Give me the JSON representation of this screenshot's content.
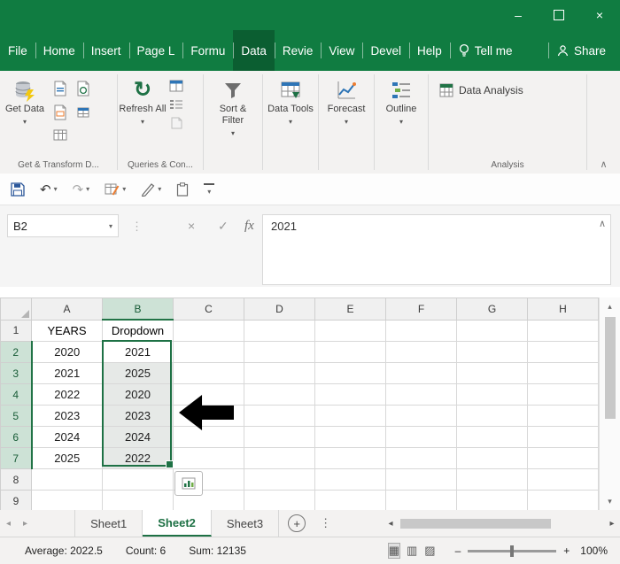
{
  "icons": {
    "dropdown": "▾",
    "refresh": "↻",
    "undo": "↶",
    "redo": "↷",
    "dots_v": "⋮",
    "cancel": "×",
    "check": "✓",
    "collapse": "∧",
    "scroll_up": "▴",
    "scroll_down": "▾",
    "scroll_left": "◂",
    "scroll_right": "▸",
    "add_sheet": "+",
    "minimize": "–",
    "close": "×",
    "zoom_minus": "–",
    "zoom_plus": "+",
    "view_normal": "▦",
    "view_layout": "▥",
    "view_break": "▨"
  },
  "ribbon_tabs": {
    "items": [
      {
        "label": "File"
      },
      {
        "label": "Home"
      },
      {
        "label": "Insert"
      },
      {
        "label": "Page L"
      },
      {
        "label": "Formu"
      },
      {
        "label": "Data"
      },
      {
        "label": "Revie"
      },
      {
        "label": "View"
      },
      {
        "label": "Devel"
      },
      {
        "label": "Help"
      }
    ],
    "tell_me": "Tell me",
    "share": "Share"
  },
  "ribbon": {
    "get_data": "Get Data",
    "refresh_all": "Refresh All",
    "sort_filter": "Sort & Filter",
    "data_tools": "Data Tools",
    "forecast": "Forecast",
    "outline": "Outline",
    "data_analysis": "Data Analysis",
    "captions": {
      "transform": "Get & Transform D...",
      "queries": "Queries & Con...",
      "analysis": "Analysis"
    }
  },
  "formula_bar": {
    "name_box": "B2",
    "fx": "fx",
    "value": "2021"
  },
  "grid": {
    "col_headers": [
      "A",
      "B",
      "C",
      "D",
      "E",
      "F",
      "G",
      "H"
    ],
    "row_headers": [
      "1",
      "2",
      "3",
      "4",
      "5",
      "6",
      "7",
      "8",
      "9"
    ],
    "cells": [
      [
        "YEARS",
        "Dropdown",
        "",
        "",
        "",
        "",
        "",
        ""
      ],
      [
        "2020",
        "2021",
        "",
        "",
        "",
        "",
        "",
        ""
      ],
      [
        "2021",
        "2025",
        "",
        "",
        "",
        "",
        "",
        ""
      ],
      [
        "2022",
        "2020",
        "",
        "",
        "",
        "",
        "",
        ""
      ],
      [
        "2023",
        "2023",
        "",
        "",
        "",
        "",
        "",
        ""
      ],
      [
        "2024",
        "2024",
        "",
        "",
        "",
        "",
        "",
        ""
      ],
      [
        "2025",
        "2022",
        "",
        "",
        "",
        "",
        "",
        ""
      ],
      [
        "",
        "",
        "",
        "",
        "",
        "",
        "",
        ""
      ],
      [
        "",
        "",
        "",
        "",
        "",
        "",
        "",
        ""
      ]
    ]
  },
  "sheet_tabs": {
    "items": [
      {
        "label": "Sheet1"
      },
      {
        "label": "Sheet2"
      },
      {
        "label": "Sheet3"
      }
    ]
  },
  "status_bar": {
    "average": "Average: 2022.5",
    "count": "Count: 6",
    "sum": "Sum: 12135",
    "zoom_level": "100%"
  }
}
